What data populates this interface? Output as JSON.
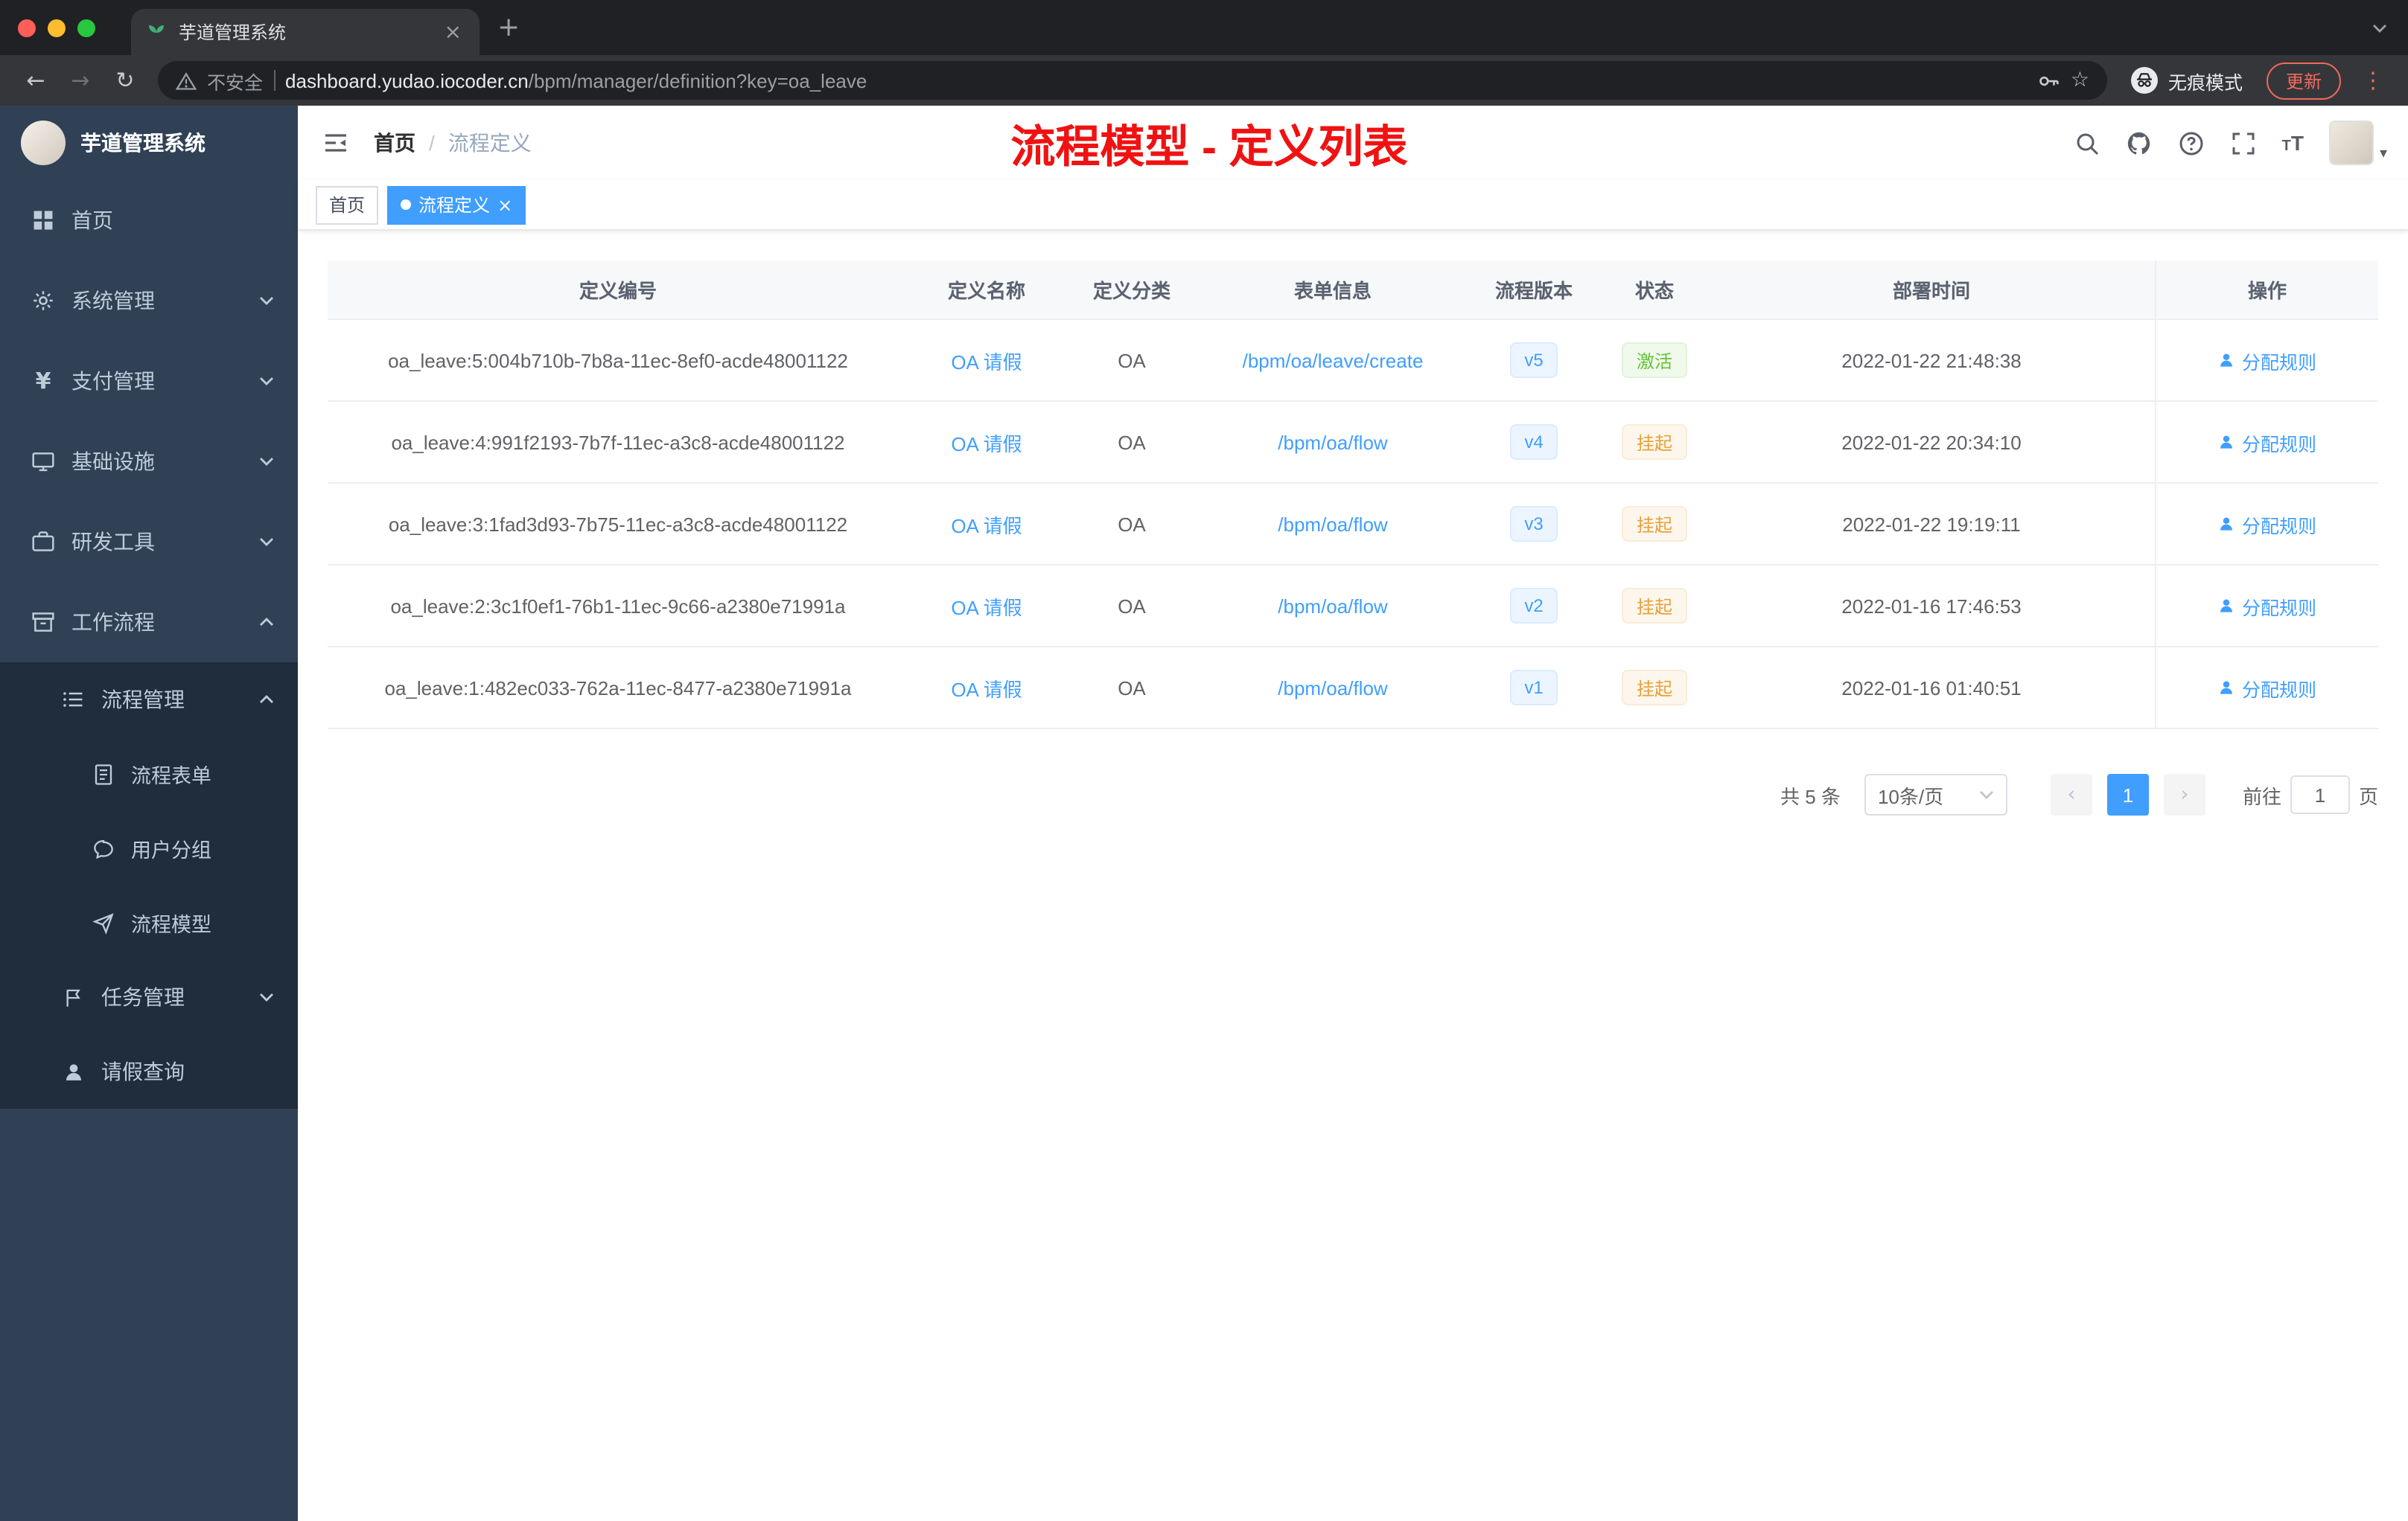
{
  "colors": {
    "accent": "#409eff",
    "success": "#67c23a",
    "warning": "#e6a23c",
    "annotation_red": "#f01212",
    "sidebar_bg": "#304156",
    "sidebar_submenu_bg": "#1f2d3d"
  },
  "glyphs": {
    "close": "×",
    "plus": "+",
    "kebab": "⋮",
    "back": "←",
    "forward": "→",
    "reload": "↻",
    "star": "☆",
    "yen": "¥",
    "caret_down": "▾",
    "t_small": "T",
    "t_large": "T"
  },
  "browser": {
    "tab_title": "芋道管理系统",
    "security_label": "不安全",
    "url_domain": "dashboard.yudao.iocoder.cn",
    "url_path": "/bpm/manager/definition?key=oa_leave",
    "incognito_label": "无痕模式",
    "update_label": "更新"
  },
  "sidebar": {
    "logo_title": "芋道管理系统",
    "items": [
      {
        "label": "首页"
      },
      {
        "label": "系统管理"
      },
      {
        "label": "支付管理"
      },
      {
        "label": "基础设施"
      },
      {
        "label": "研发工具"
      },
      {
        "label": "工作流程"
      },
      {
        "label": "流程管理"
      },
      {
        "label": "流程表单"
      },
      {
        "label": "用户分组"
      },
      {
        "label": "流程模型"
      },
      {
        "label": "任务管理"
      },
      {
        "label": "请假查询"
      }
    ]
  },
  "header": {
    "breadcrumb_home": "首页",
    "breadcrumb_separator": "/",
    "breadcrumb_current": "流程定义",
    "annotation": "流程模型 - 定义列表"
  },
  "tags": {
    "items": [
      {
        "label": "首页",
        "active": false
      },
      {
        "label": "流程定义",
        "active": true
      }
    ]
  },
  "table": {
    "headers": [
      "定义编号",
      "定义名称",
      "定义分类",
      "表单信息",
      "流程版本",
      "状态",
      "部署时间",
      "操作"
    ],
    "rows": [
      {
        "id": "oa_leave:5:004b710b-7b8a-11ec-8ef0-acde48001122",
        "name": "OA 请假",
        "category": "OA",
        "form": "/bpm/oa/leave/create",
        "version": "v5",
        "status": "激活",
        "status_type": "active",
        "time": "2022-01-22 21:48:38",
        "action": "分配规则"
      },
      {
        "id": "oa_leave:4:991f2193-7b7f-11ec-a3c8-acde48001122",
        "name": "OA 请假",
        "category": "OA",
        "form": "/bpm/oa/flow",
        "version": "v4",
        "status": "挂起",
        "status_type": "suspended",
        "time": "2022-01-22 20:34:10",
        "action": "分配规则"
      },
      {
        "id": "oa_leave:3:1fad3d93-7b75-11ec-a3c8-acde48001122",
        "name": "OA 请假",
        "category": "OA",
        "form": "/bpm/oa/flow",
        "version": "v3",
        "status": "挂起",
        "status_type": "suspended",
        "time": "2022-01-22 19:19:11",
        "action": "分配规则"
      },
      {
        "id": "oa_leave:2:3c1f0ef1-76b1-11ec-9c66-a2380e71991a",
        "name": "OA 请假",
        "category": "OA",
        "form": "/bpm/oa/flow",
        "version": "v2",
        "status": "挂起",
        "status_type": "suspended",
        "time": "2022-01-16 17:46:53",
        "action": "分配规则"
      },
      {
        "id": "oa_leave:1:482ec033-762a-11ec-8477-a2380e71991a",
        "name": "OA 请假",
        "category": "OA",
        "form": "/bpm/oa/flow",
        "version": "v1",
        "status": "挂起",
        "status_type": "suspended",
        "time": "2022-01-16 01:40:51",
        "action": "分配规则"
      }
    ]
  },
  "pagination": {
    "total": "共 5 条",
    "page_size": "10条/页",
    "prev": "‹",
    "current_page": "1",
    "next": "›",
    "goto_label": "前往",
    "goto_value": "1",
    "unit_label": "页"
  }
}
